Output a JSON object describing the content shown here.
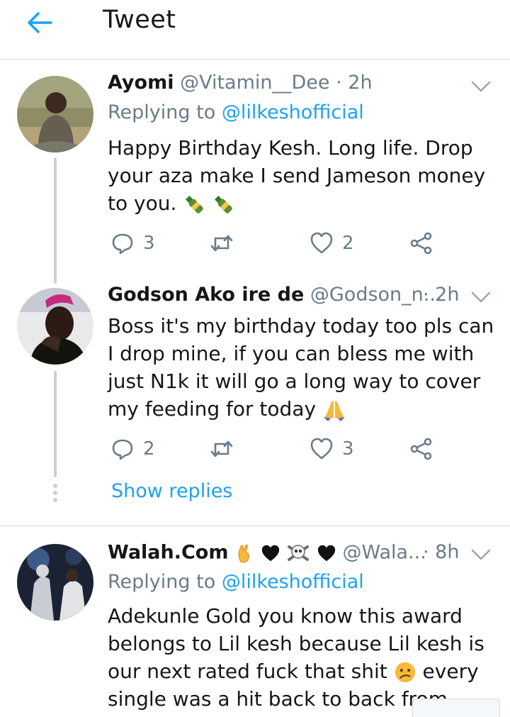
{
  "header": {
    "title": "Tweet",
    "back_icon": "arrow-left-icon",
    "accent": "#1da1f2"
  },
  "tweets": [
    {
      "name": "Ayomi",
      "handle": "@Vitamin__Dee",
      "time": "· 2h",
      "replying_label": "Replying to",
      "replying_to": "@lilkeshofficial",
      "text": "Happy Birthday Kesh. Long life. Drop your aza make I send Jameson money to you.",
      "emojis": [
        "bottle-emoji",
        "bottle-emoji"
      ],
      "replies": "3",
      "likes": "2"
    },
    {
      "name": "Godson Ako ire de",
      "handle": "@Godson_n...",
      "time": "· 2h",
      "text": "Boss it's my birthday today too pls can I drop mine, if you can bless me with just N1k it will go a long way to cover my feeding for today",
      "emojis": [
        "folded-hands-emoji"
      ],
      "replies": "2",
      "likes": "3",
      "show_replies": "Show replies"
    },
    {
      "name": "Walah.Com",
      "name_emojis": [
        "crossed-fingers-emoji",
        "black-heart-emoji",
        "skull-crossbones-emoji",
        "black-heart-emoji"
      ],
      "handle": "@Wala...",
      "time": "· 8h",
      "replying_label": "Replying to",
      "replying_to": "@lilkeshofficial",
      "text": "Adekunle Gold you know this award belongs to Lil kesh because Lil kesh is our next rated fuck that shit",
      "emoji_mid": "confused-face-emoji",
      "text_after": "every single was a hit back to back from"
    }
  ]
}
